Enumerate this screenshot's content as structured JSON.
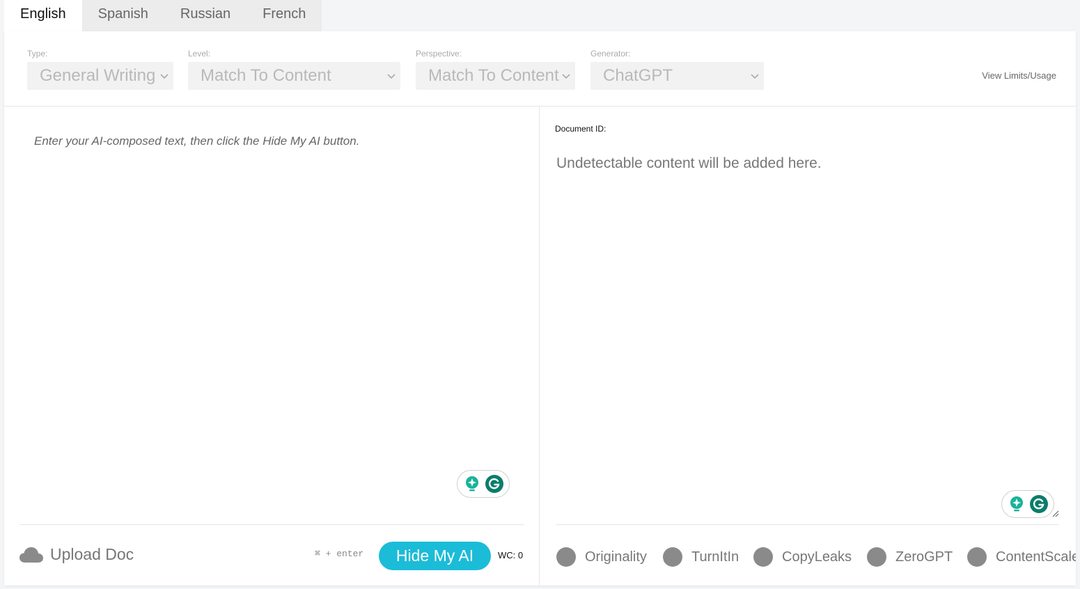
{
  "tabs": [
    {
      "label": "English",
      "active": true
    },
    {
      "label": "Spanish",
      "active": false
    },
    {
      "label": "Russian",
      "active": false
    },
    {
      "label": "French",
      "active": false
    }
  ],
  "settings": {
    "type": {
      "label": "Type:",
      "value": "General Writing"
    },
    "level": {
      "label": "Level:",
      "value": "Match To Content"
    },
    "perspective": {
      "label": "Perspective:",
      "value": "Match To Content"
    },
    "generator": {
      "label": "Generator:",
      "value": "ChatGPT"
    },
    "view_limits": "View Limits/Usage"
  },
  "input": {
    "placeholder": "Enter your AI-composed text, then click the Hide My AI button.",
    "value": ""
  },
  "actions": {
    "upload_label": "Upload Doc",
    "shortcut": "⌘ + enter",
    "hide_button": "Hide My AI",
    "word_count": "WC: 0"
  },
  "output": {
    "document_id_label": "Document ID:",
    "placeholder": "Undetectable content will be added here."
  },
  "detectors": [
    {
      "label": "Originality"
    },
    {
      "label": "TurnItIn"
    },
    {
      "label": "CopyLeaks"
    },
    {
      "label": "ZeroGPT"
    },
    {
      "label": "ContentScale"
    }
  ],
  "colors": {
    "accent": "#1bbcd7",
    "grammarly": "#0a7d6c",
    "detector_dot": "#8a8a8a"
  },
  "icons": {
    "upload": "cloud-icon",
    "select": "chevron-down-icon",
    "assist": [
      "lightbulb-icon",
      "grammarly-icon"
    ]
  }
}
